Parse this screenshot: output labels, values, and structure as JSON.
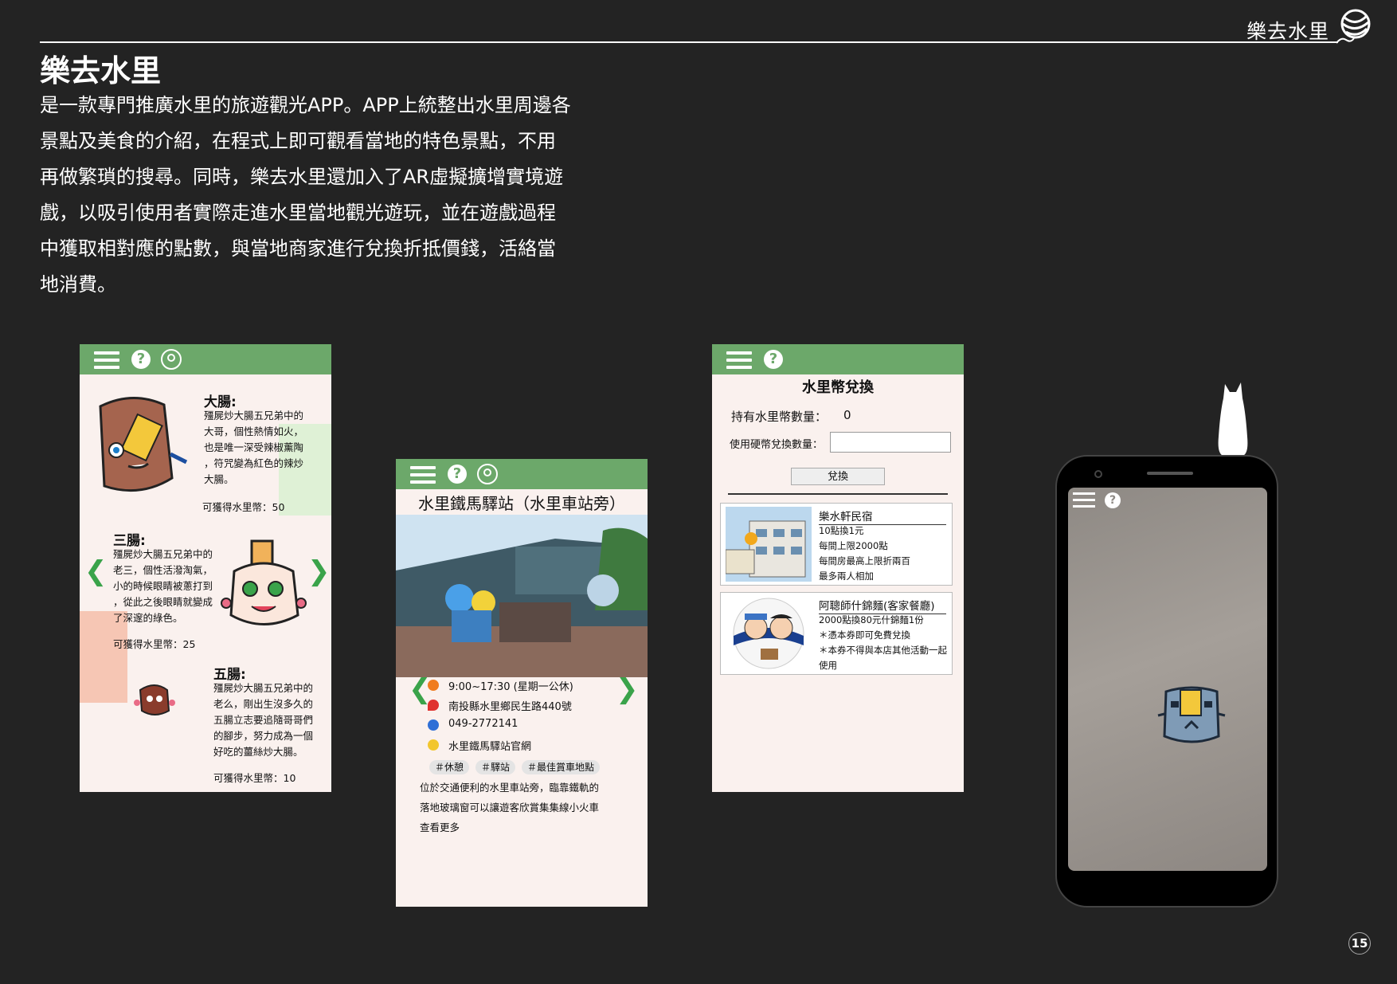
{
  "header": {
    "brand": "樂去水里"
  },
  "page": {
    "title": "樂去水里",
    "intro_lines": [
      "是一款專門推廣水里的旅遊觀光APP。APP上統整出水里周邊各",
      "景點及美食的介紹，在程式上即可觀看當地的特色景點，不用",
      "再做繁瑣的搜尋。同時，樂去水里還加入了AR虛擬擴增實境遊",
      "戲，以吸引使用者實際走進水里當地觀光遊玩，並在遊戲過程",
      "中獲取相對應的點數，與當地商家進行兌換折抵價錢，活絡當",
      "地消費。"
    ],
    "page_number": "15"
  },
  "screen1": {
    "icons": [
      "menu-icon",
      "help-icon",
      "location-icon"
    ],
    "items": [
      {
        "name": "大腸:",
        "desc_lines": [
          "殭屍炒大腸五兄弟中的",
          "大哥，個性熱情如火，",
          "也是唯一深受辣椒薰陶",
          "，符咒變為紅色的辣炒",
          "大腸。"
        ],
        "coin": "可獲得水里幣：50"
      },
      {
        "name": "三腸:",
        "desc_lines": [
          "殭屍炒大腸五兄弟中的",
          "老三，個性活潑淘氣，",
          "小的時候眼睛被蔥打到",
          "，從此之後眼睛就變成",
          "了深邃的綠色。"
        ],
        "coin": "可獲得水里幣：25"
      },
      {
        "name": "五腸:",
        "desc_lines": [
          "殭屍炒大腸五兄弟中的",
          "老么，剛出生沒多久的",
          "五腸立志要追隨哥哥們",
          "的腳步，努力成為一個",
          "好吃的薑絲炒大腸。"
        ],
        "coin": "可獲得水里幣：10"
      }
    ],
    "colors": {
      "bar": "#6ca86a",
      "chevron": "#3aa34a"
    }
  },
  "screen2": {
    "title": "水里鐵馬驛站（水里車站旁）",
    "hours": "9:00~17:30 (星期一公休)",
    "address": "南投縣水里鄉民生路440號",
    "phone": "049-2772141",
    "website": "水里鐵馬驛站官網",
    "tags": [
      "＃休憩",
      "＃驛站",
      "＃最佳賞車地點"
    ],
    "desc_lines": [
      "位於交通便利的水里車站旁，臨靠鐵軌的",
      "落地玻璃窗可以讓遊客欣賞集集線小火車"
    ],
    "more": "查看更多"
  },
  "screen3": {
    "title": "水里幣兌換",
    "held_label": "持有水里幣數量：",
    "held_value": "0",
    "use_label": "使用硬幣兌換數量：",
    "use_value": "",
    "button": "兌換",
    "cards": [
      {
        "title": "樂水軒民宿",
        "lines": [
          "10點換1元",
          "每間上限2000點",
          "每間房最高上限折兩百",
          "最多兩人相加"
        ]
      },
      {
        "title": "阿聰師什錦麵(客家餐廳)",
        "lines": [
          "2000點換80元什錦麵1份",
          "＊憑本券即可免費兌換",
          "＊本券不得與本店其他活動一起",
          "使用"
        ]
      }
    ]
  }
}
